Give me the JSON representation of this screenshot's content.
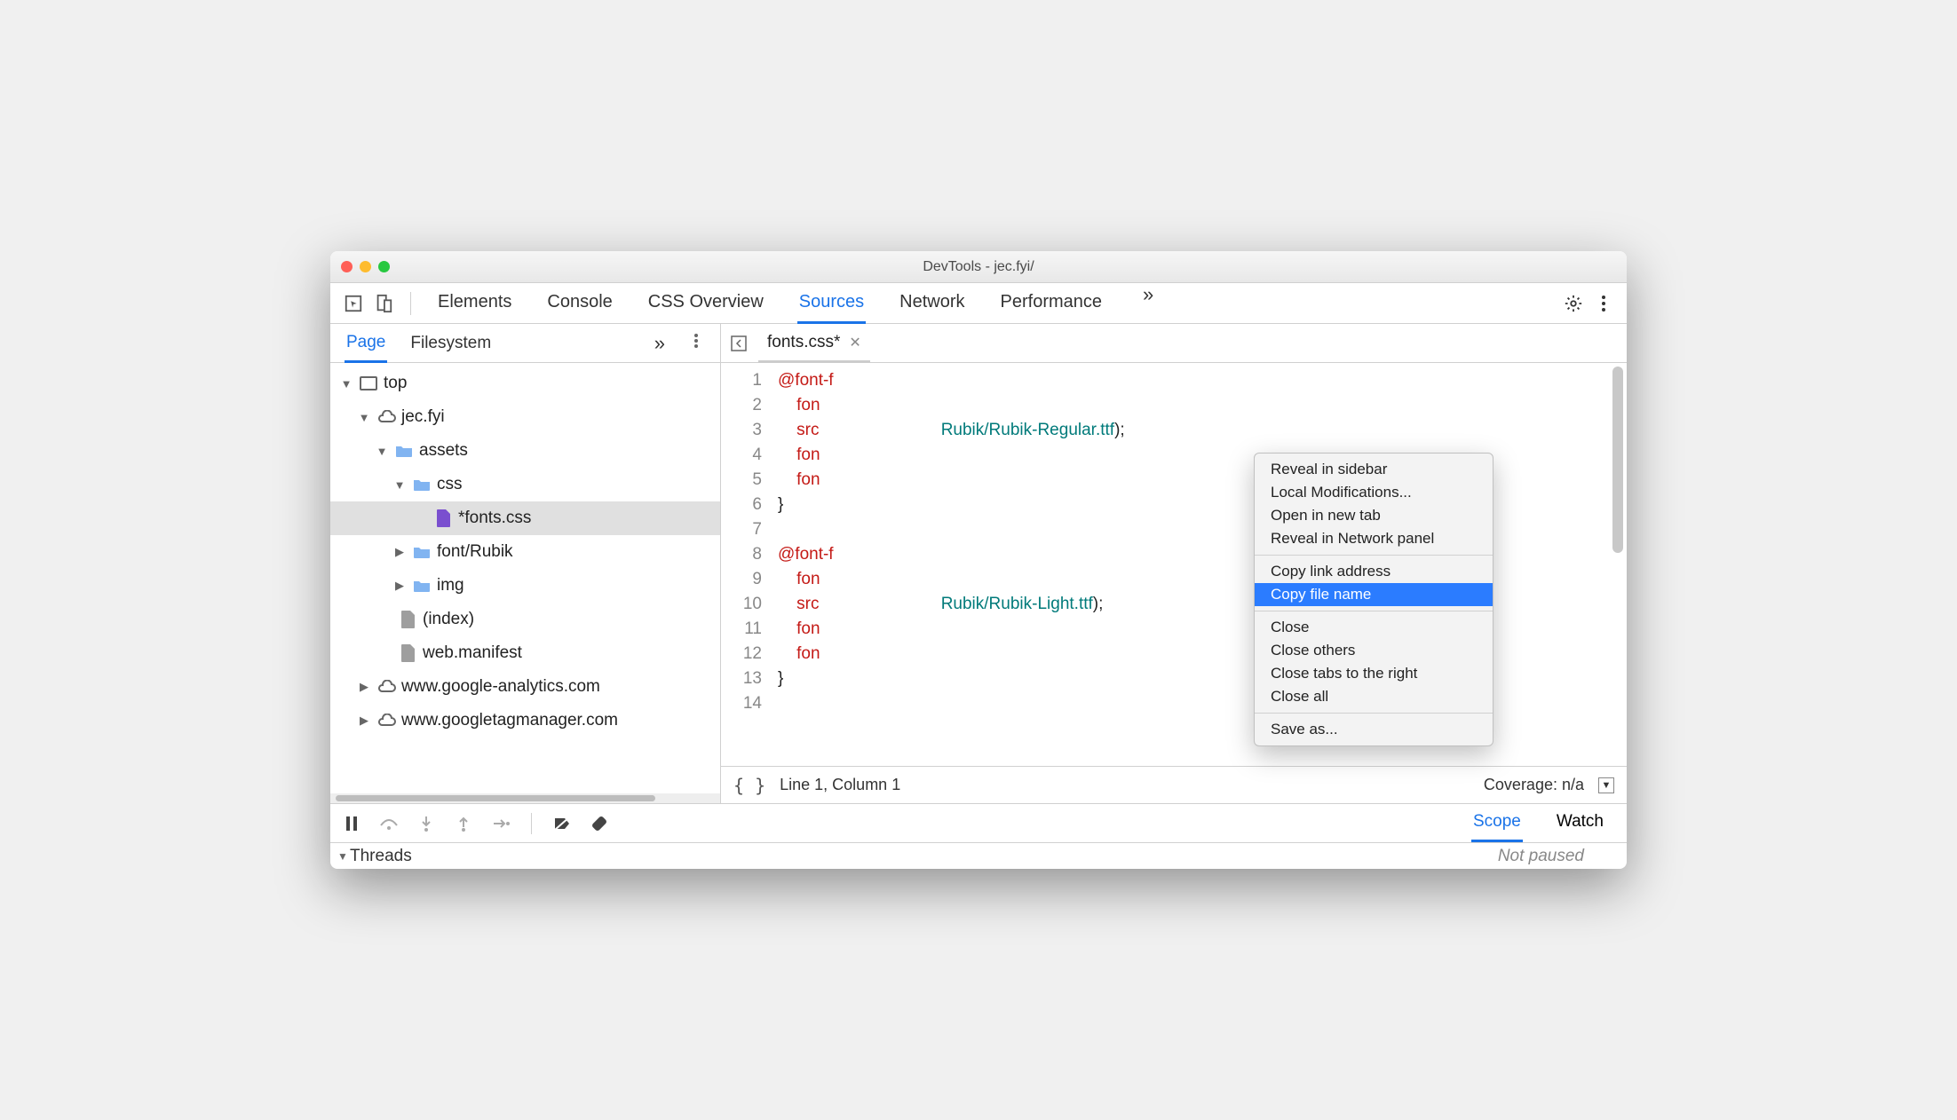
{
  "window": {
    "title": "DevTools - jec.fyi/"
  },
  "toolbar": {
    "tabs": [
      "Elements",
      "Console",
      "CSS Overview",
      "Sources",
      "Network",
      "Performance"
    ],
    "active": "Sources",
    "overflow": "»"
  },
  "sidebar": {
    "tabs": {
      "page": "Page",
      "filesystem": "Filesystem",
      "overflow": "»"
    },
    "tree": {
      "top": "top",
      "domain": "jec.fyi",
      "assets": "assets",
      "css": "css",
      "fontscss": "*fonts.css",
      "fontrubik": "font/Rubik",
      "img": "img",
      "index": "(index)",
      "webmanifest": "web.manifest",
      "ga": "www.google-analytics.com",
      "gtm": "www.googletagmanager.com"
    }
  },
  "editor": {
    "tab_name": "fonts.css*",
    "gutter": "1\n2\n3\n4\n5\n6\n7\n8\n9\n10\n11\n12\n13\n14",
    "lines": [
      {
        "segments": [
          {
            "t": "@font-f",
            "c": "tok-rule"
          }
        ]
      },
      {
        "segments": [
          {
            "t": "    fon",
            "c": "tok-rule"
          }
        ]
      },
      {
        "segments": [
          {
            "t": "    src",
            "c": "tok-rule"
          },
          {
            "t": "                          Rubik/Rubik-Regular.ttf",
            "c": "tok-str"
          },
          {
            "t": ");",
            "c": ""
          }
        ]
      },
      {
        "segments": [
          {
            "t": "    fon",
            "c": "tok-rule"
          }
        ]
      },
      {
        "segments": [
          {
            "t": "    fon",
            "c": "tok-rule"
          }
        ]
      },
      {
        "segments": [
          {
            "t": "}",
            "c": ""
          }
        ]
      },
      {
        "segments": [
          {
            "t": "",
            "c": ""
          }
        ]
      },
      {
        "segments": [
          {
            "t": "@font-f",
            "c": "tok-rule"
          }
        ]
      },
      {
        "segments": [
          {
            "t": "    fon",
            "c": "tok-rule"
          }
        ]
      },
      {
        "segments": [
          {
            "t": "    src",
            "c": "tok-rule"
          },
          {
            "t": "                          Rubik/Rubik-Light.ttf",
            "c": "tok-str"
          },
          {
            "t": ");",
            "c": ""
          }
        ]
      },
      {
        "segments": [
          {
            "t": "    fon",
            "c": "tok-rule"
          }
        ]
      },
      {
        "segments": [
          {
            "t": "    fon",
            "c": "tok-rule"
          }
        ]
      },
      {
        "segments": [
          {
            "t": "}",
            "c": ""
          }
        ]
      },
      {
        "segments": [
          {
            "t": "",
            "c": ""
          }
        ]
      }
    ]
  },
  "status": {
    "format": "{ }",
    "pos": "Line 1, Column 1",
    "coverage": "Coverage: n/a"
  },
  "debug": {
    "tabs": {
      "scope": "Scope",
      "watch": "Watch"
    }
  },
  "footer": {
    "threads": "Threads",
    "status": "Not paused"
  },
  "context_menu": {
    "reveal_sidebar": "Reveal in sidebar",
    "local_mod": "Local Modifications...",
    "open_tab": "Open in new tab",
    "reveal_network": "Reveal in Network panel",
    "copy_link": "Copy link address",
    "copy_name": "Copy file name",
    "close": "Close",
    "close_others": "Close others",
    "close_right": "Close tabs to the right",
    "close_all": "Close all",
    "save_as": "Save as..."
  }
}
